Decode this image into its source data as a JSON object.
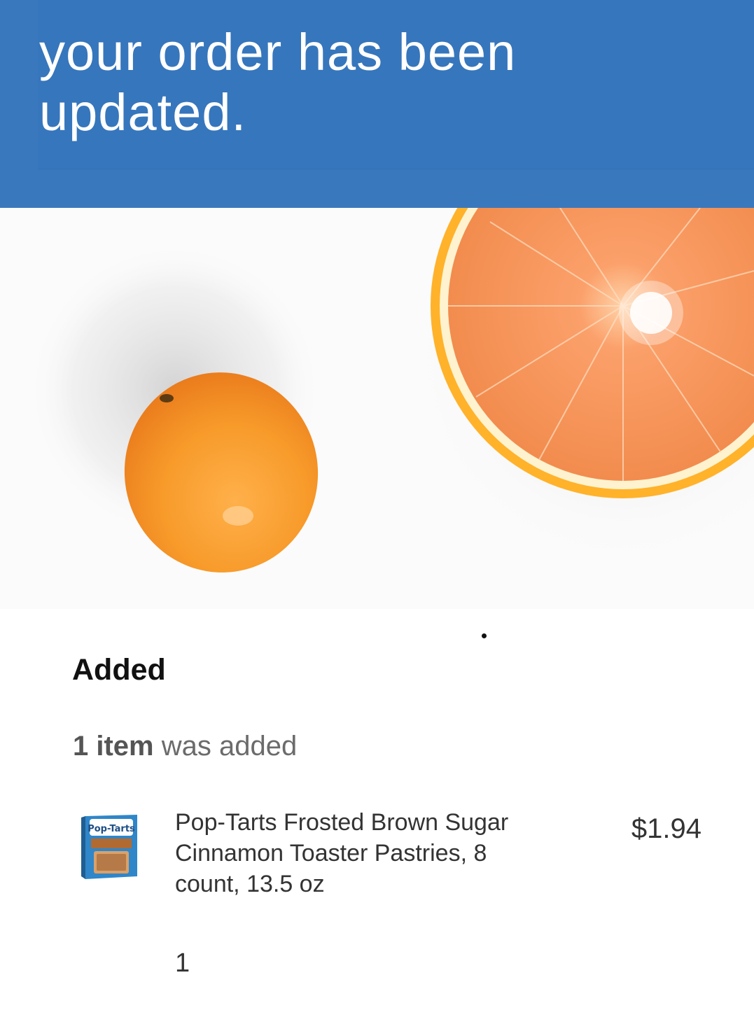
{
  "header": {
    "headline_line1": "your order has been",
    "headline_line2": "updated.",
    "bg_color": "#3676bc"
  },
  "hero": {
    "image": "oranges-photo"
  },
  "added_section": {
    "title": "Added",
    "count_bold": "1 item",
    "count_rest": " was added"
  },
  "items": [
    {
      "thumb": "pop-tarts-box",
      "thumb_brand_text": "Pop-Tarts",
      "name": "Pop-Tarts Frosted Brown Sugar Cinnamon Toaster Pastries, 8 count, 13.5 oz",
      "price": "$1.94",
      "quantity": "1"
    }
  ]
}
